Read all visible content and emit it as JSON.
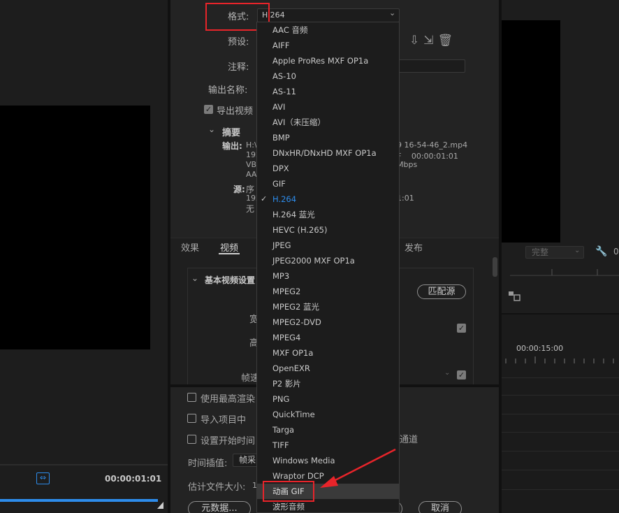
{
  "source_panel": {
    "timecode": "00:00:01:01"
  },
  "export_settings": {
    "format_label": "格式:",
    "format_value": "H.264",
    "preset_label": "预设:",
    "comment_label": "注释:",
    "output_name_label": "输出名称:",
    "export_video_label": "导出视频",
    "checkmark": "✓",
    "summary": {
      "title": "摘要",
      "output_label": "输出:",
      "output_lines": [
        "H:\\",
        "192",
        "VB",
        "AA"
      ],
      "output_right_lines": [
        "9  16-54-46_2.mp4",
        "F　 00:00:01:01",
        "Mbps"
      ],
      "source_label": "源:",
      "source_lines": [
        "序",
        "192",
        "无"
      ],
      "source_right_lines": [
        "",
        "1:01"
      ]
    }
  },
  "tabs": {
    "effects": "效果",
    "video": "视频",
    "publish": "发布"
  },
  "video_settings": {
    "basic_title": "基本视频设置",
    "match_source": "匹配源",
    "width_label": "宽",
    "height_label": "高",
    "fps_label": "帧速"
  },
  "bottom": {
    "max_render": "使用最高渲染",
    "import_project": "导入项目中",
    "set_timecode": "设置开始时间",
    "alpha_tail": "通道",
    "interp_label": "时间插值:",
    "interp_value": "帧采",
    "filesize_label": "估计文件大小:",
    "filesize_value": "1",
    "metadata_btn": "元数据...",
    "cancel_btn": "取消"
  },
  "format_options": [
    "AAC 音频",
    "AIFF",
    "Apple ProRes MXF OP1a",
    "AS-10",
    "AS-11",
    "AVI",
    "AVI（未压缩）",
    "BMP",
    "DNxHR/DNxHD MXF OP1a",
    "DPX",
    "GIF",
    "H.264",
    "H.264 蓝光",
    "HEVC (H.265)",
    "JPEG",
    "JPEG2000 MXF OP1a",
    "MP3",
    "MPEG2",
    "MPEG2 蓝光",
    "MPEG2-DVD",
    "MPEG4",
    "MXF OP1a",
    "OpenEXR",
    "P2 影片",
    "PNG",
    "QuickTime",
    "Targa",
    "TIFF",
    "Windows Media",
    "Wraptor DCP",
    "动画 GIF",
    "波形音频"
  ],
  "program_panel": {
    "quality": "完整",
    "zero": "0",
    "timeline_tc": "00:00:15:00"
  },
  "colors": {
    "accent": "#2d8ceb",
    "highlight_red": "#e8242a"
  }
}
